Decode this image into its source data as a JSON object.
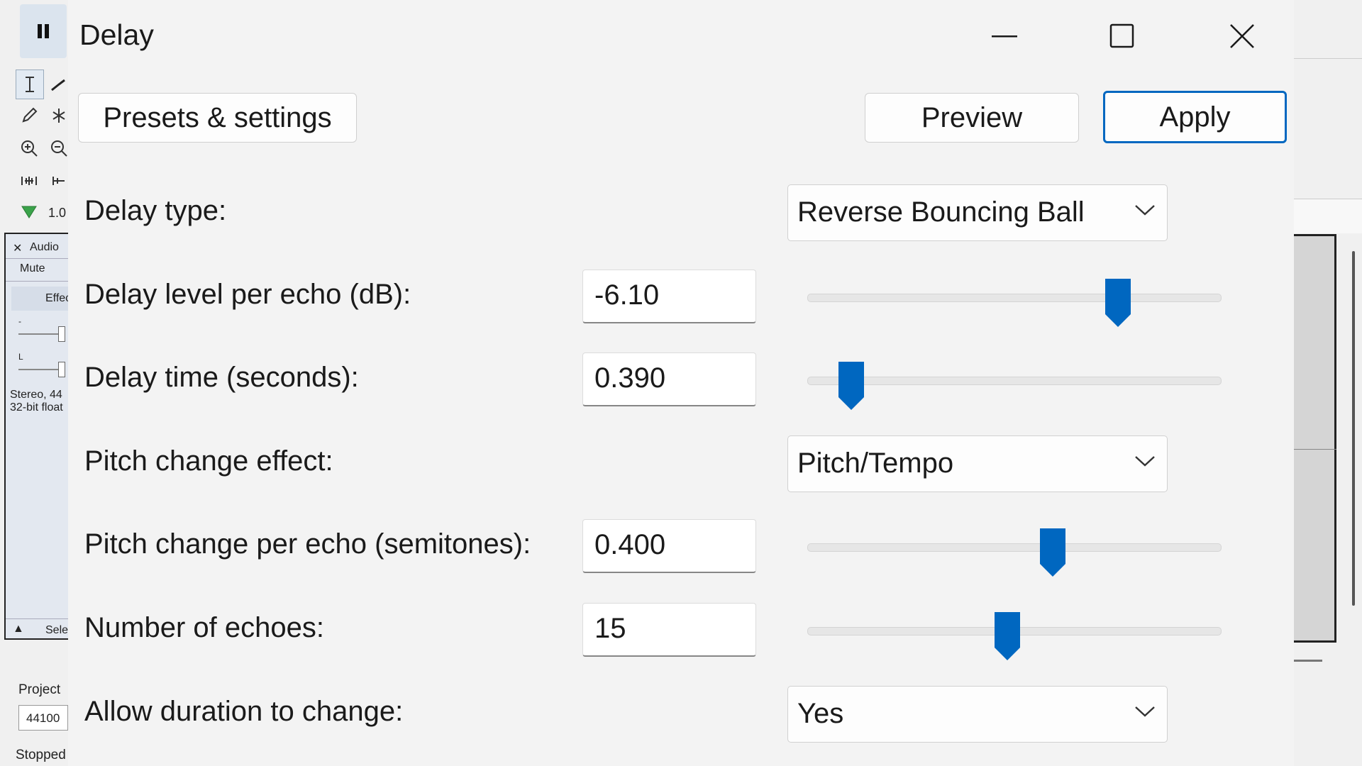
{
  "background": {
    "track": {
      "close_label": "✕",
      "name": "Audio",
      "mute_label": "Mute",
      "effects_label": "Effec",
      "gain_label": "-",
      "pan_label": "L",
      "format_line1": "Stereo, 44",
      "format_line2": "32-bit float",
      "select_label": "Sele"
    },
    "project_rate_label": "Project",
    "project_rate_value": "44100",
    "status_text": "Stopped",
    "zoom_value": "1.0"
  },
  "dialog": {
    "title": "Delay",
    "presets_label": "Presets & settings",
    "preview_label": "Preview",
    "apply_label": "Apply",
    "accent_color": "#0067c0",
    "rows": {
      "delay_type": {
        "label": "Delay type:",
        "value": "Reverse Bouncing Ball"
      },
      "delay_level": {
        "label": "Delay level per echo (dB):",
        "value": "-6.10",
        "slider_fraction": 0.75
      },
      "delay_time": {
        "label": "Delay time (seconds):",
        "value": "0.390",
        "slider_fraction": 0.106
      },
      "pitch_effect": {
        "label": "Pitch change effect:",
        "value": "Pitch/Tempo"
      },
      "pitch_per_echo": {
        "label": "Pitch change per echo (semitones):",
        "value": "0.400",
        "slider_fraction": 0.592
      },
      "echoes": {
        "label": "Number of echoes:",
        "value": "15",
        "slider_fraction": 0.483
      },
      "allow_duration": {
        "label": "Allow duration to change:",
        "value": "Yes"
      }
    }
  }
}
